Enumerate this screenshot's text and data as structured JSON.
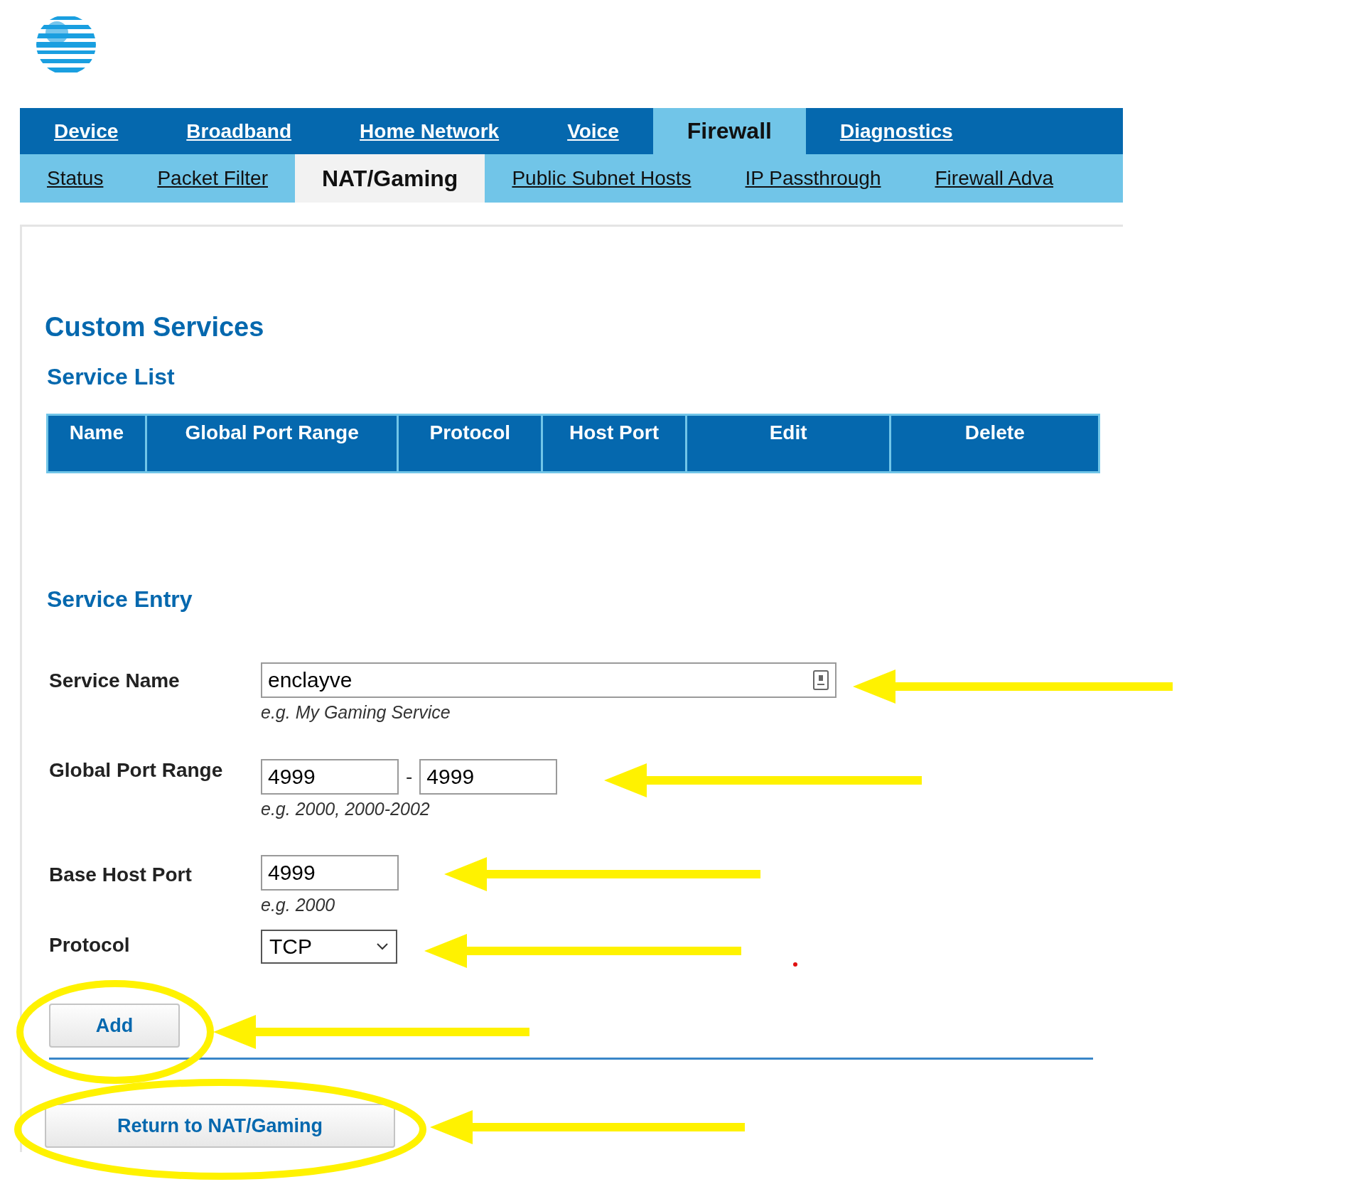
{
  "nav": {
    "main_tabs": [
      {
        "label": "Device",
        "selected": false
      },
      {
        "label": "Broadband",
        "selected": false
      },
      {
        "label": "Home Network",
        "selected": false
      },
      {
        "label": "Voice",
        "selected": false
      },
      {
        "label": "Firewall",
        "selected": true
      },
      {
        "label": "Diagnostics",
        "selected": false
      }
    ],
    "sub_tabs": [
      {
        "label": "Status",
        "selected": false
      },
      {
        "label": "Packet Filter",
        "selected": false
      },
      {
        "label": "NAT/Gaming",
        "selected": true
      },
      {
        "label": "Public Subnet Hosts",
        "selected": false
      },
      {
        "label": "IP Passthrough",
        "selected": false
      },
      {
        "label": "Firewall Adva",
        "selected": false
      }
    ]
  },
  "title": "Custom Services",
  "service_list": {
    "title": "Service List",
    "columns": [
      "Name",
      "Global Port Range",
      "Protocol",
      "Host Port",
      "Edit",
      "Delete"
    ]
  },
  "service_entry": {
    "title": "Service Entry",
    "fields": [
      {
        "kind": "text",
        "label": "Service Name",
        "values": [
          "enclayve"
        ],
        "hint": "e.g. My Gaming Service"
      },
      {
        "kind": "range",
        "label": "Global Port Range",
        "values": [
          "4999",
          "4999"
        ],
        "separator": "-",
        "hint": "e.g. 2000, 2000-2002"
      },
      {
        "kind": "short",
        "label": "Base Host Port",
        "values": [
          "4999"
        ],
        "hint": "e.g. 2000"
      },
      {
        "kind": "select",
        "label": "Protocol",
        "values": [
          "TCP"
        ]
      }
    ]
  },
  "add_button": "Add",
  "return_button": "Return to NAT/Gaming"
}
